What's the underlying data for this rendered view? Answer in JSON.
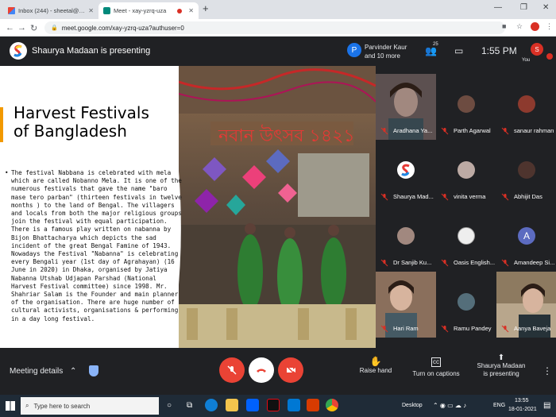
{
  "browser": {
    "tabs": [
      {
        "label": "Inbox (244) - sheetal@theindian",
        "icon": "gmail-icon"
      },
      {
        "label": "Meet - xay-yzrq-uza",
        "icon": "meet-icon"
      }
    ],
    "url": "meet.google.com/xay-yzrq-uza?authuser=0"
  },
  "meet": {
    "presenting_banner": "Shaurya Madaan is presenting",
    "pinned_avatar_letter": "P",
    "pinned_name_line1": "Parvinder Kaur",
    "pinned_name_line2": "and 10 more",
    "people_count": "25",
    "time": "1:55 PM",
    "you_avatar_letter": "S",
    "you_label": "You"
  },
  "slide": {
    "title": "Harvest Festivals of Bangladesh",
    "bullet": "•",
    "body": "The festival Nabbana is celebrated with mela which are called Nobanno Mela. It is one of the numerous festivals that gave the name \"baro mase tero parban\" (thirteen festivals in twelve months ) to the land of Bengal. The villagers and locals from both the major religious groups join the festival with equal participation. There is a famous play written on nabanna by Bijon Bhattacharya which depicts the sad incident of the great Bengal Famine of 1943. Nowadays the Festival \"Nabanna\" is celebrating every Bengali year (1st day of Agrahayan) (16 June in 2020) in Dhaka, organised by Jatiya Nabanna Utshab Udjapan Parshad (National Harvest Festival committee) since 1998. Mr. Shahriar Salam is the Founder and main planner of the organisation. There are huge number of cultural activists, organisations & performing in a day long festival."
  },
  "participants": [
    {
      "name": "Aradhana Ya...",
      "type": "video"
    },
    {
      "name": "Parth Agarwal",
      "type": "avatar"
    },
    {
      "name": "sanaur rahman",
      "type": "avatar"
    },
    {
      "name": "Shaurya Mad...",
      "type": "logo"
    },
    {
      "name": "vinita verma",
      "type": "avatar"
    },
    {
      "name": "Abhijit Das",
      "type": "avatar"
    },
    {
      "name": "Dr Sanjib Ku...",
      "type": "avatar"
    },
    {
      "name": "Oasis English...",
      "type": "avatar"
    },
    {
      "name": "Amandeep Si...",
      "type": "letter",
      "letter": "A"
    },
    {
      "name": "Hari Ram",
      "type": "video"
    },
    {
      "name": "Ramu Pandey",
      "type": "avatar"
    },
    {
      "name": "Aanya Baveja",
      "type": "video"
    }
  ],
  "controls": {
    "meeting_details": "Meeting details",
    "raise_hand": "Raise hand",
    "captions": "Turn on captions",
    "present_line1": "Shaurya Madaan",
    "present_line2": "is presenting"
  },
  "taskbar": {
    "search_placeholder": "Type here to search",
    "desktop": "Desktop",
    "lang": "ENG",
    "time": "13:55",
    "date": "18-01-2021"
  },
  "colors": {
    "accent_orange": "#f29900",
    "end_call_red": "#ea4335",
    "meet_background": "#202124"
  }
}
